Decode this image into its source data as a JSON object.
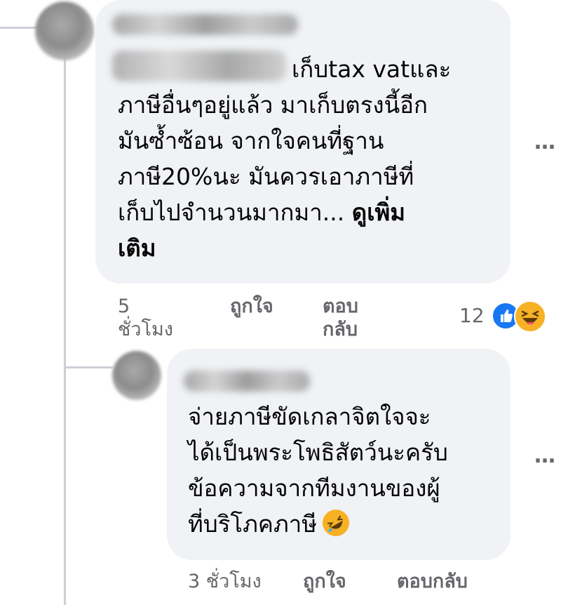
{
  "comments": [
    {
      "text": "เก็บtax vatและ\nภาษีอื่นๆอยู่แล้ว มาเก็บตรงนี้อีก\nมันซ้ำซ้อน จากใจคนที่ฐาน\nภาษี20%นะ มันควรเอาภาษีที่\nเก็บไปจำนวนมากมา...",
      "see_more": "ดูเพิ่ม\nเติม",
      "time": "5\nชั่วโมง",
      "like_label": "ถูกใจ",
      "reply_label": "ตอบ\nกลับ",
      "reaction_count": "12",
      "reaction_icons": [
        "like-icon",
        "haha-icon"
      ],
      "more_icon": "…"
    },
    {
      "text": "จ่ายภาษีขัดเกลาจิตใจจะ\nได้เป็นพระโพธิสัตว์นะครับ\nข้อความจากทีมงานของผู้\nที่บริโภคภาษี",
      "inline_emoji": "rolling-on-floor-laughing-icon",
      "time": "3 ชั่วโมง",
      "like_label": "ถูกใจ",
      "reply_label": "ตอบกลับ",
      "more_icon": "…"
    }
  ],
  "colors": {
    "bubble": "#f0f2f5",
    "meta_text": "#65676b",
    "like_blue": "#1877f2",
    "haha_yellow": "#f7b125",
    "thread_line": "#ccd0d5"
  }
}
